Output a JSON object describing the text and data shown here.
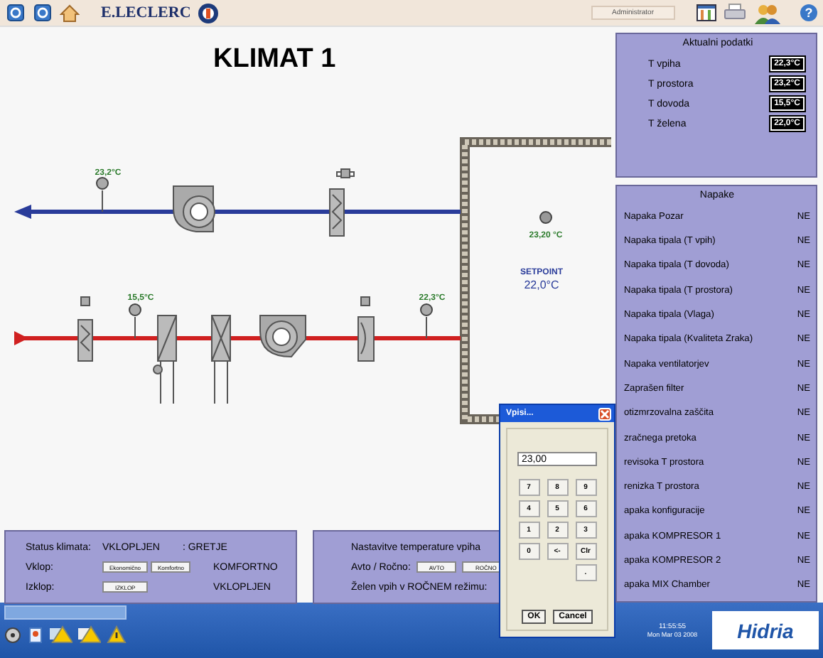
{
  "toolbar": {
    "brand": "E.LECLERC",
    "user": "Administrator",
    "help_glyph": "?"
  },
  "title": "KLIMAT 1",
  "diagram": {
    "exhaust_temp": "23,2°C",
    "outdoor_temp": "15,5°C",
    "supply_temp": "22,3°C",
    "room_temp": "23,20 °C",
    "setpoint_label": "SETPOINT",
    "setpoint": "22,0°C"
  },
  "current_data": {
    "title": "Aktualni podatki",
    "rows": [
      {
        "label": "T vpiha",
        "value": "22,3°C"
      },
      {
        "label": "T prostora",
        "value": "23,2°C"
      },
      {
        "label": "T dovoda",
        "value": "15,5°C"
      },
      {
        "label": "T želena",
        "value": "22,0°C"
      }
    ]
  },
  "errors": {
    "title": "Napake",
    "rows": [
      {
        "label": "Napaka Pozar",
        "value": "NE"
      },
      {
        "label": "Napaka tipala (T vpih)",
        "value": "NE"
      },
      {
        "label": "Napaka tipala (T dovoda)",
        "value": "NE"
      },
      {
        "label": "Napaka tipala (T prostora)",
        "value": "NE"
      },
      {
        "label": "Napaka tipala (Vlaga)",
        "value": "NE"
      },
      {
        "label": "Napaka tipala (Kvaliteta Zraka)",
        "value": "NE"
      },
      {
        "label": "Napaka ventilatorjev",
        "value": "NE"
      },
      {
        "label": "Zaprašen filter",
        "value": "NE"
      },
      {
        "label": "otizmrzovalna zaščita",
        "value": "NE"
      },
      {
        "label": "zračnega pretoka",
        "value": "NE"
      },
      {
        "label": "revisoka T prostora",
        "value": "NE"
      },
      {
        "label": "renizka T prostora",
        "value": "NE"
      },
      {
        "label": "apaka konfiguracije",
        "value": "NE"
      },
      {
        "label": "apaka KOMPRESOR 1",
        "value": "NE"
      },
      {
        "label": "apaka KOMPRESOR 2",
        "value": "NE"
      },
      {
        "label": "apaka MIX Chamber",
        "value": "NE"
      }
    ]
  },
  "status_panel": {
    "status_label": "Status klimata:",
    "status_value": "VKLOPLJEN",
    "mode_value": ": GRETJE",
    "on_label": "Vklop:",
    "on_buttons": [
      "Ekonomično",
      "Komfortno"
    ],
    "on_value": "KOMFORTNO",
    "off_label": "Izklop:",
    "off_button": "IZKLOP",
    "off_value": "VKLOPLJEN"
  },
  "supply_panel": {
    "title": "Nastavitve temperature vpiha",
    "mode_label": "Avto / Ročno:",
    "mode_buttons": [
      "AVTO",
      "ROČNO"
    ],
    "manual_label": "Želen vpih v ROČNEM režimu:"
  },
  "dialog": {
    "title": "Vpisi...",
    "value": "23,00",
    "keys": [
      "7",
      "8",
      "9",
      "4",
      "5",
      "6",
      "1",
      "2",
      "3",
      "0",
      "<-",
      "Clr",
      "."
    ],
    "ok": "OK",
    "cancel": "Cancel"
  },
  "taskbar": {
    "logo": "Hidria",
    "time": "11:55:55",
    "date": "Mon Mar 03 2008"
  }
}
